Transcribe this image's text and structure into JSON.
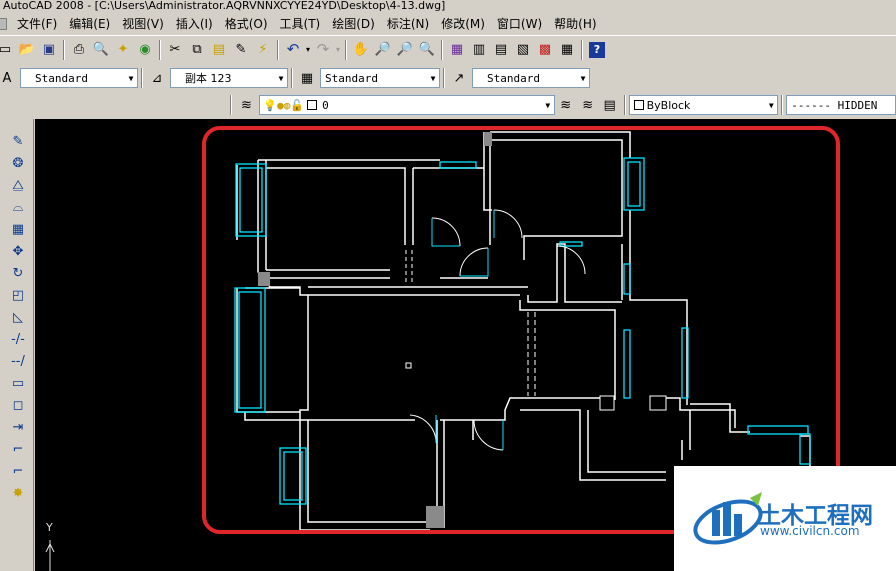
{
  "window": {
    "title": "AutoCAD 2008 - [C:\\Users\\Administrator.AQRVNNXCYYE24YD\\Desktop\\4-13.dwg]"
  },
  "menu": [
    "文件(F)",
    "编辑(E)",
    "视图(V)",
    "插入(I)",
    "格式(O)",
    "工具(T)",
    "绘图(D)",
    "标注(N)",
    "修改(M)",
    "窗口(W)",
    "帮助(H)"
  ],
  "styles_toolbar": {
    "text_style": "Standard",
    "dim_style": "副本 123",
    "table_style": "Standard",
    "multileader_style": "Standard"
  },
  "layers_toolbar": {
    "current_layer": "0",
    "color": "ByBlock",
    "linetype": "------ HIDDEN"
  },
  "ucs": {
    "y_label": "Y"
  },
  "watermark": {
    "title": "土木工程网",
    "url": "www.civilcn.com"
  },
  "colors": {
    "highlight": "#e0262b",
    "window": "#00e5ff",
    "wall": "#ffffff",
    "background": "#000000"
  },
  "icons": {
    "standard_toolbar": [
      "new-icon",
      "open-icon",
      "save-icon",
      "print-icon",
      "preview-icon",
      "publish-icon",
      "3d-dwf-icon",
      "cut-icon",
      "copy-icon",
      "paste-icon",
      "matchprop-icon",
      "block-editor-icon",
      "undo-icon",
      "redo-icon",
      "pan-icon",
      "zoom-realtime-icon",
      "zoom-window-icon",
      "zoom-previous-icon",
      "properties-icon",
      "design-center-icon",
      "tool-palettes-icon",
      "sheet-set-icon",
      "markup-icon",
      "calculator-icon",
      "help-icon"
    ],
    "modify_toolbar": [
      "erase-icon",
      "copy-object-icon",
      "mirror-icon",
      "offset-icon",
      "array-icon",
      "move-icon",
      "rotate-icon",
      "scale-icon",
      "stretch-icon",
      "trim-icon",
      "extend-icon",
      "break-icon",
      "chamfer-icon",
      "join-icon",
      "fillet-icon",
      "explode-icon"
    ]
  }
}
